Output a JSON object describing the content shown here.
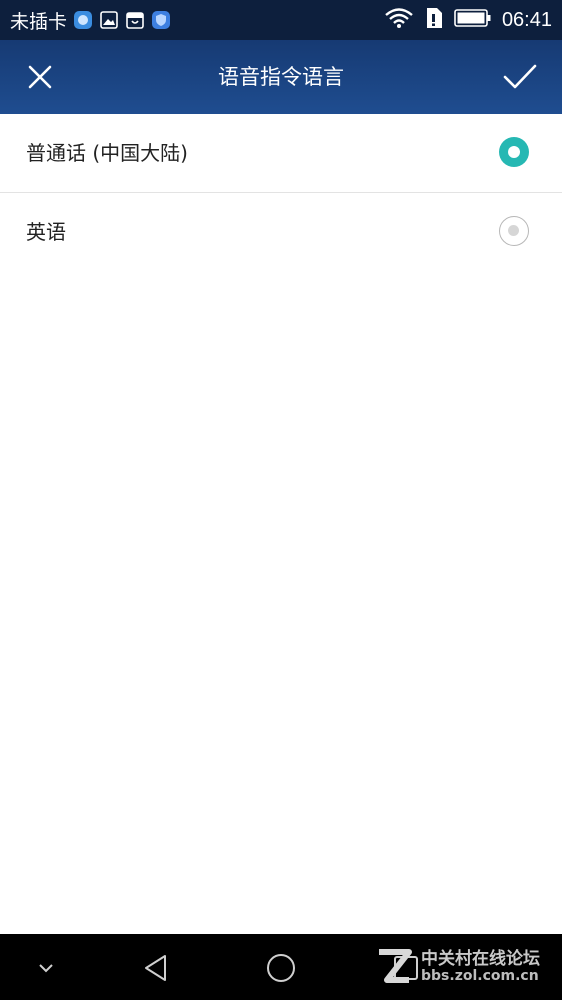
{
  "status_bar": {
    "carrier": "未插卡",
    "time": "06:41",
    "left_icons": [
      "app-icon",
      "gallery-icon",
      "store-icon",
      "shield-icon"
    ],
    "right_icons": [
      "wifi-icon",
      "sim-icon",
      "battery-icon"
    ]
  },
  "app_bar": {
    "title": "语音指令语言",
    "close_icon": "close-icon",
    "confirm_icon": "check-icon"
  },
  "options": [
    {
      "label": "普通话 (中国大陆)",
      "selected": true
    },
    {
      "label": "英语",
      "selected": false
    }
  ],
  "nav_bar": {
    "buttons": [
      "chevron-down-icon",
      "back-icon",
      "home-icon",
      "recent-apps-icon"
    ]
  },
  "watermark": {
    "name": "中关村在线论坛",
    "url": "bbs.zol.com.cn"
  },
  "colors": {
    "app_bar": "#1f4d90",
    "status_bar": "#0d1f3d",
    "radio_selected": "#26b8b3"
  }
}
